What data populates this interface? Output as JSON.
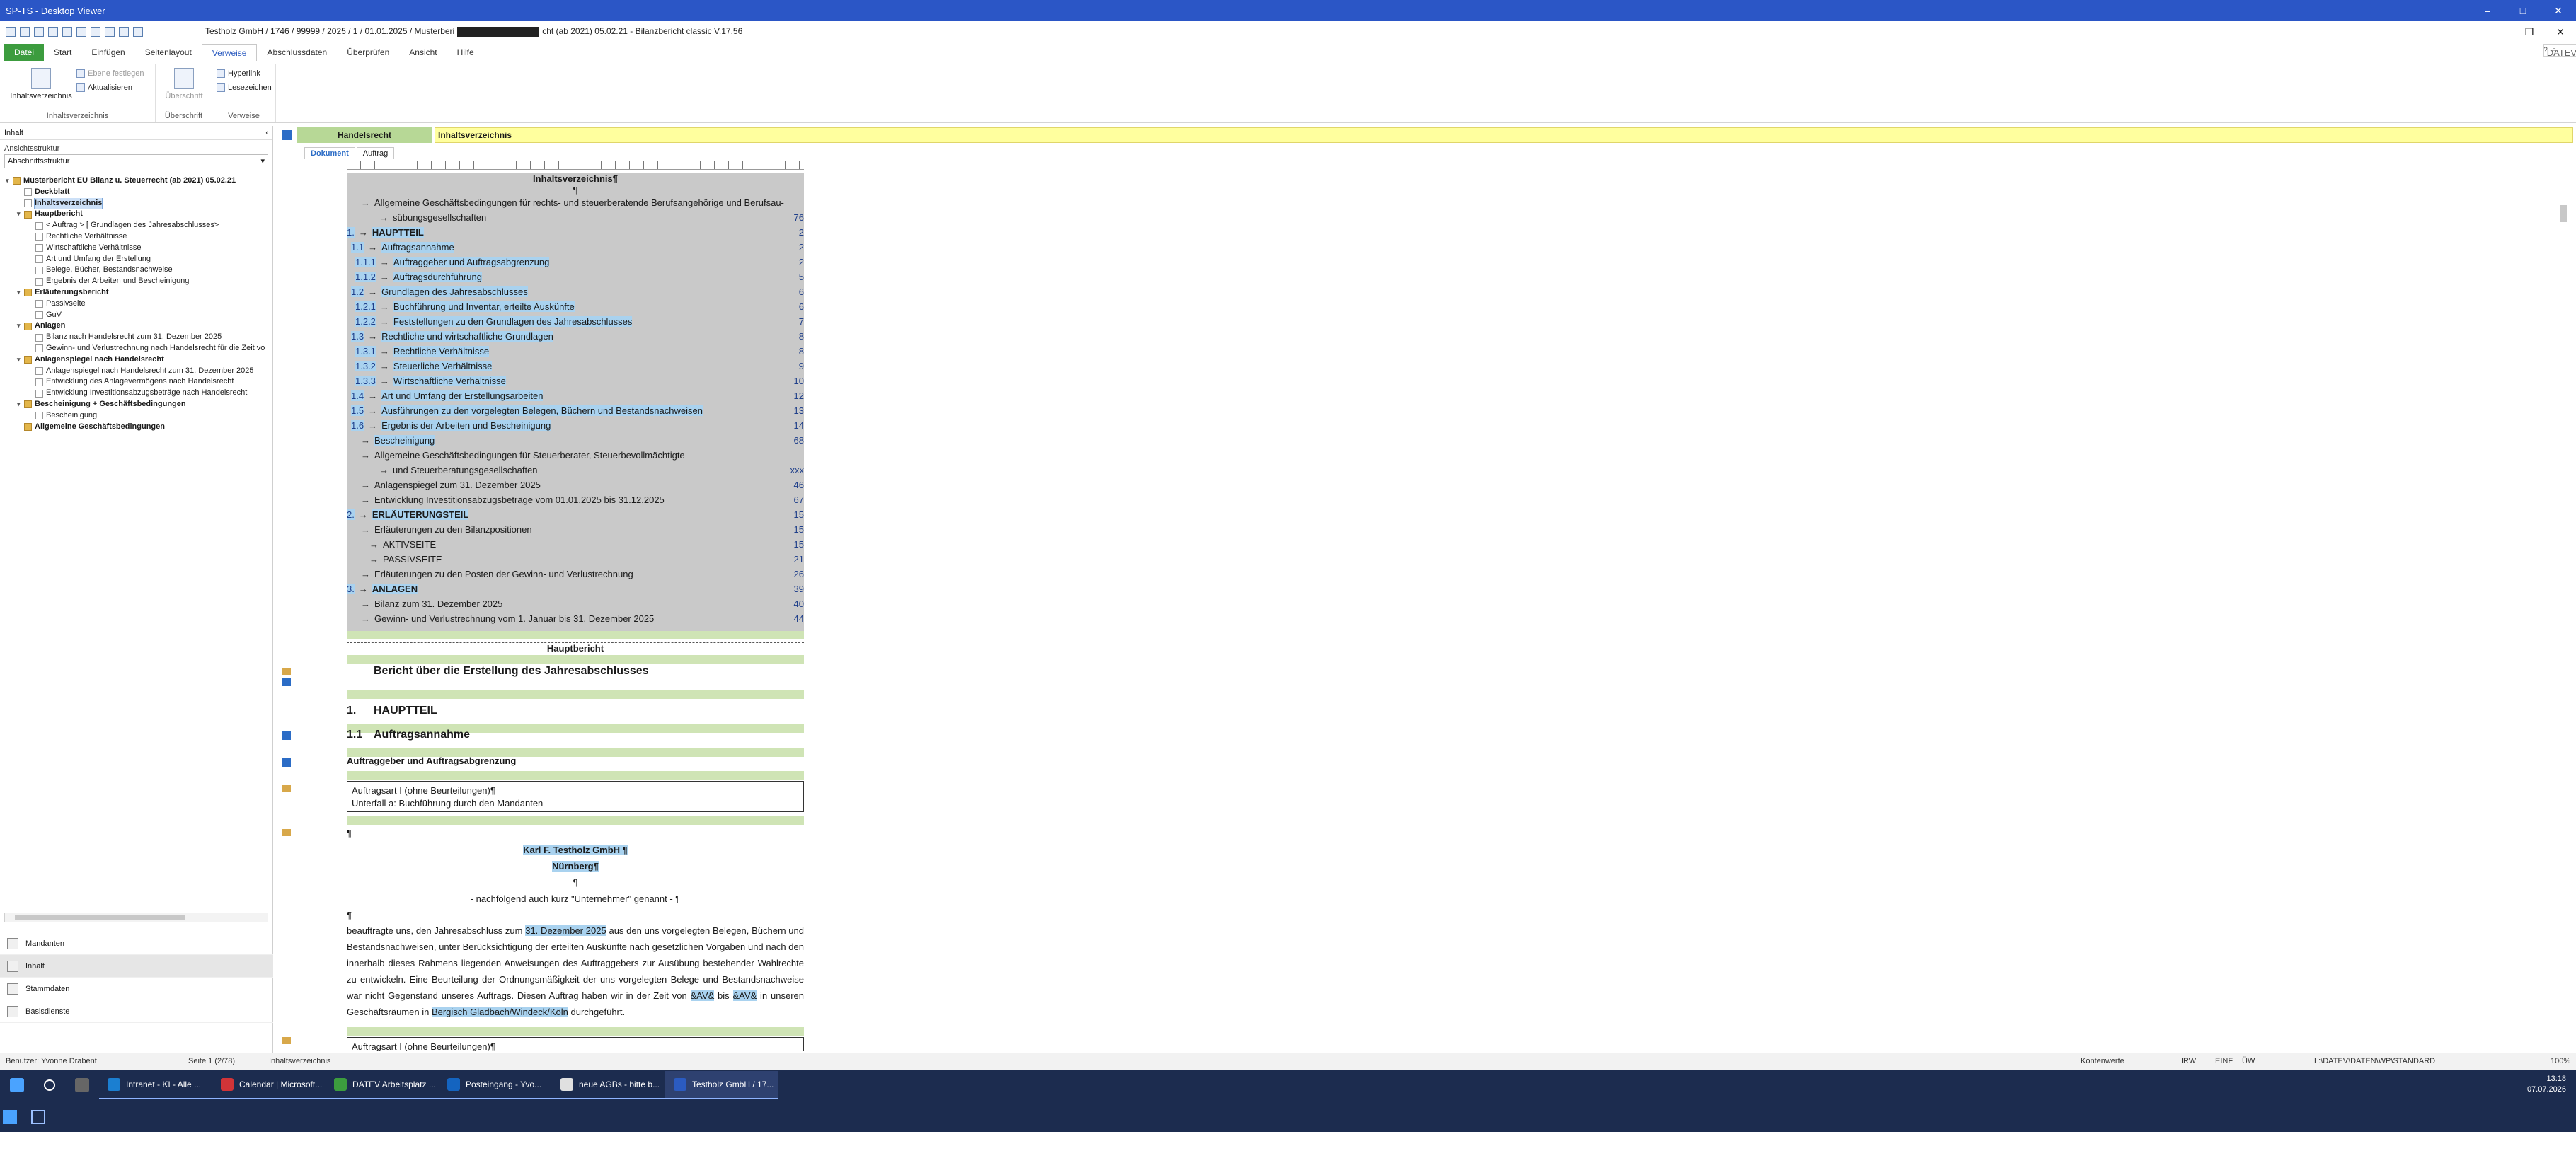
{
  "window": {
    "title": "SP-TS - Desktop Viewer",
    "controls": [
      "–",
      "□",
      "✕"
    ]
  },
  "quickaccess": {
    "doc_title_left": "Testholz GmbH / 1746 / 99999 / 2025 / 1 / 01.01.2025 / Musterberi",
    "doc_title_right": "cht (ab 2021) 05.02.21 - Bilanzbericht classic V.17.56",
    "controls": [
      "–",
      "❐",
      "✕"
    ]
  },
  "ribbon_tabs": [
    "Datei",
    "Start",
    "Einfügen",
    "Seitenlayout",
    "Verweise",
    "Abschlussdaten",
    "Überprüfen",
    "Ansicht",
    "Hilfe"
  ],
  "help": {
    "label": "DATEV Hilfe-Center"
  },
  "ribbon": {
    "inhaltsverzeichnis": "Inhaltsverzeichnis",
    "ebene_festlegen": "Ebene festlegen",
    "aktualisieren": "Aktualisieren",
    "group_inhalt": "Inhaltsverzeichnis",
    "ueberschrift": "Überschrift",
    "group_ueberschrift": "Überschrift",
    "hyperlink": "Hyperlink",
    "lesezeichen": "Lesezeichen",
    "group_verweise": "Verweise"
  },
  "leftpane": {
    "header": "Inhalt",
    "label": "Ansichtsstruktur",
    "select_value": "Abschnittsstruktur",
    "tree": [
      {
        "label": "Musterbericht EU Bilanz u. Steuerrecht (ab 2021) 05.02.21",
        "level": 0,
        "bold": true,
        "toggle": "▾",
        "folder": true
      },
      {
        "label": "Deckblatt",
        "level": 1,
        "bold": true,
        "toggle": "",
        "folder": false
      },
      {
        "label": "Inhaltsverzeichnis",
        "level": 1,
        "bold": true,
        "toggle": "",
        "folder": false,
        "selected": true
      },
      {
        "label": "Hauptbericht",
        "level": 1,
        "bold": true,
        "toggle": "▾",
        "folder": true
      },
      {
        "label": "< Auftrag > [ Grundlagen des Jahresabschlusses>",
        "level": 2,
        "bold": false,
        "toggle": "",
        "folder": false
      },
      {
        "label": "Rechtliche Verhältnisse",
        "level": 2,
        "bold": false,
        "toggle": "",
        "folder": false
      },
      {
        "label": "Wirtschaftliche Verhältnisse",
        "level": 2,
        "bold": false,
        "toggle": "",
        "folder": false
      },
      {
        "label": "Art und Umfang der Erstellung",
        "level": 2,
        "bold": false,
        "toggle": "",
        "folder": false
      },
      {
        "label": "Belege, Bücher, Bestandsnachweise",
        "level": 2,
        "bold": false,
        "toggle": "",
        "folder": false
      },
      {
        "label": "Ergebnis der Arbeiten und Bescheinigung",
        "level": 2,
        "bold": false,
        "toggle": "",
        "folder": false
      },
      {
        "label": "Erläuterungsbericht",
        "level": 1,
        "bold": true,
        "toggle": "▾",
        "folder": true
      },
      {
        "label": "Passivseite",
        "level": 2,
        "bold": false,
        "toggle": "",
        "folder": false
      },
      {
        "label": "GuV",
        "level": 2,
        "bold": false,
        "toggle": "",
        "folder": false
      },
      {
        "label": "Anlagen",
        "level": 1,
        "bold": true,
        "toggle": "▾",
        "folder": true
      },
      {
        "label": "Bilanz nach Handelsrecht zum 31. Dezember 2025",
        "level": 2,
        "bold": false,
        "toggle": "",
        "folder": false
      },
      {
        "label": "Gewinn- und Verlustrechnung nach Handelsrecht für die Zeit vo",
        "level": 2,
        "bold": false,
        "toggle": "",
        "folder": false
      },
      {
        "label": "Anlagenspiegel nach Handelsrecht",
        "level": 1,
        "bold": true,
        "toggle": "▾",
        "folder": true
      },
      {
        "label": "Anlagenspiegel nach Handelsrecht zum 31. Dezember 2025",
        "level": 2,
        "bold": false,
        "toggle": "",
        "folder": false
      },
      {
        "label": "Entwicklung des Anlagevermögens nach Handelsrecht",
        "level": 2,
        "bold": false,
        "toggle": "",
        "folder": false
      },
      {
        "label": "Entwicklung Investitionsabzugsbeträge nach Handelsrecht",
        "level": 2,
        "bold": false,
        "toggle": "",
        "folder": false
      },
      {
        "label": "Bescheinigung + Geschäftsbedingungen",
        "level": 1,
        "bold": true,
        "toggle": "▾",
        "folder": true
      },
      {
        "label": "Bescheinigung",
        "level": 2,
        "bold": false,
        "toggle": "",
        "folder": false
      },
      {
        "label": "Allgemeine Geschäftsbedingungen",
        "level": 1,
        "bold": true,
        "toggle": "",
        "folder": true
      }
    ],
    "nav": [
      "Mandanten",
      "Inhalt",
      "Stammdaten",
      "Basisdienste"
    ]
  },
  "docbar": {
    "handelsrecht": "Handelsrecht",
    "inhaltsverzeichnis": "Inhaltsverzeichnis",
    "tabs": [
      "Dokument",
      "Auftrag"
    ]
  },
  "toc": {
    "title": "Inhaltsverzeichnis¶",
    "para": "¶",
    "rows": [
      {
        "num": "",
        "text": "Allgemeine Geschäftsbedingungen für rechts- und steuerberatende Berufsangehörige und Berufsau-",
        "page": "",
        "bold": false,
        "hl": false,
        "indent": 14
      },
      {
        "num": "",
        "text": "sübungsgesellschaften",
        "page": "76",
        "bold": false,
        "hl": false,
        "indent": 40
      },
      {
        "num": "1.",
        "text": "HAUPTTEIL",
        "page": "2",
        "bold": true,
        "hl": true,
        "indent": 0
      },
      {
        "num": "1.1",
        "text": "Auftragsannahme",
        "page": "2",
        "bold": false,
        "hl": true,
        "indent": 6
      },
      {
        "num": "1.1.1",
        "text": "Auftraggeber und Auftragsabgrenzung",
        "page": "2",
        "bold": false,
        "hl": true,
        "indent": 12
      },
      {
        "num": "1.1.2",
        "text": "Auftragsdurchführung",
        "page": "5",
        "bold": false,
        "hl": true,
        "indent": 12
      },
      {
        "num": "1.2",
        "text": "Grundlagen des Jahresabschlusses",
        "page": "6",
        "bold": false,
        "hl": true,
        "indent": 6
      },
      {
        "num": "1.2.1",
        "text": "Buchführung und Inventar, erteilte Auskünfte",
        "page": "6",
        "bold": false,
        "hl": true,
        "indent": 12
      },
      {
        "num": "1.2.2",
        "text": "Feststellungen zu den Grundlagen des Jahresabschlusses",
        "page": "7",
        "bold": false,
        "hl": true,
        "indent": 12
      },
      {
        "num": "1.3",
        "text": "Rechtliche und wirtschaftliche Grundlagen",
        "page": "8",
        "bold": false,
        "hl": true,
        "indent": 6
      },
      {
        "num": "1.3.1",
        "text": "Rechtliche Verhältnisse",
        "page": "8",
        "bold": false,
        "hl": true,
        "indent": 12
      },
      {
        "num": "1.3.2",
        "text": "Steuerliche Verhältnisse",
        "page": "9",
        "bold": false,
        "hl": true,
        "indent": 12
      },
      {
        "num": "1.3.3",
        "text": "Wirtschaftliche Verhältnisse",
        "page": "10",
        "bold": false,
        "hl": true,
        "indent": 12
      },
      {
        "num": "1.4",
        "text": "Art und Umfang der Erstellungsarbeiten",
        "page": "12",
        "bold": false,
        "hl": true,
        "indent": 6
      },
      {
        "num": "1.5",
        "text": "Ausführungen zu den vorgelegten Belegen, Büchern und Bestandsnachweisen",
        "page": "13",
        "bold": false,
        "hl": true,
        "indent": 6
      },
      {
        "num": "1.6",
        "text": "Ergebnis der Arbeiten und Bescheinigung",
        "page": "14",
        "bold": false,
        "hl": true,
        "indent": 6
      },
      {
        "num": "",
        "text": "Bescheinigung",
        "page": "68",
        "bold": false,
        "hl": true,
        "indent": 14
      },
      {
        "num": "",
        "text": "Allgemeine Geschäftsbedingungen für Steuerberater, Steuerbevollmächtigte",
        "page": "",
        "bold": false,
        "hl": false,
        "indent": 14
      },
      {
        "num": "",
        "text": "und Steuerberatungsgesellschaften",
        "page": "xxx",
        "bold": false,
        "hl": false,
        "indent": 40
      },
      {
        "num": "",
        "text": "Anlagenspiegel zum 31. Dezember 2025",
        "page": "46",
        "bold": false,
        "hl": false,
        "indent": 14
      },
      {
        "num": "",
        "text": "Entwicklung Investitionsabzugsbeträge vom 01.01.2025 bis 31.12.2025",
        "page": "67",
        "bold": false,
        "hl": false,
        "indent": 14
      },
      {
        "num": "2.",
        "text": "ERLÄUTERUNGSTEIL",
        "page": "15",
        "bold": true,
        "hl": true,
        "indent": 0
      },
      {
        "num": "",
        "text": "Erläuterungen zu den Bilanzpositionen",
        "page": "15",
        "bold": false,
        "hl": false,
        "indent": 14
      },
      {
        "num": "",
        "text": "AKTIVSEITE",
        "page": "15",
        "bold": false,
        "hl": false,
        "indent": 26
      },
      {
        "num": "",
        "text": "PASSIVSEITE",
        "page": "21",
        "bold": false,
        "hl": false,
        "indent": 26
      },
      {
        "num": "",
        "text": "Erläuterungen zu den Posten der Gewinn- und Verlustrechnung",
        "page": "26",
        "bold": false,
        "hl": false,
        "indent": 14
      },
      {
        "num": "3.",
        "text": "ANLAGEN",
        "page": "39",
        "bold": true,
        "hl": true,
        "indent": 0
      },
      {
        "num": "",
        "text": "Bilanz zum 31. Dezember 2025",
        "page": "40",
        "bold": false,
        "hl": false,
        "indent": 14
      },
      {
        "num": "",
        "text": "Gewinn- und Verlustrechnung vom 1. Januar bis 31. Dezember 2025",
        "page": "44",
        "bold": false,
        "hl": false,
        "indent": 14
      }
    ]
  },
  "body": {
    "section": "Hauptbericht",
    "heading": "Bericht über die Erstellung des Jahresabschlusses",
    "h1_num": "1.",
    "h1": "HAUPTTEIL",
    "h2_num": "1.1",
    "h2": "Auftragsannahme",
    "h3": "Auftraggeber und Auftragsabgrenzung",
    "box_line1": "Auftragsart I (ohne Beurteilungen)¶",
    "box_line2": "Unterfall a: Buchführung durch den Mandanten",
    "para1": "¶",
    "company": "Karl F. Testholz GmbH ¶",
    "city": "Nürnberg¶",
    "para2": "¶",
    "alias": "- nachfolgend auch kurz \"Unternehmer\" genannt - ¶",
    "para3": "¶",
    "text_a": "beauftragte uns, den Jahresabschluss zum ",
    "text_date": "31. Dezember 2025",
    "text_b": " aus den uns vorgelegten Belegen, Büchern und Bestandsnachweisen, unter Berücksichtigung der erteilten Auskünfte nach gesetzlichen Vorgaben und nach den innerhalb dieses Rahmens liegenden Anweisungen des Auftraggebers zur Ausübung bestehender Wahlrechte zu entwickeln. Eine Beurteilung der Ordnungsmäßigkeit der uns vorgelegten Belege und Bestandsnachweise war nicht Gegenstand unseres Auftrags. Diesen Auftrag haben wir in der Zeit von ",
    "text_av1": "&AV&",
    "text_c": " bis ",
    "text_av2": "&AV&",
    "text_d": " in unseren Geschäftsräumen in ",
    "text_place": "Bergisch Gladbach/Windeck/Köln",
    "text_e": " durchgeführt.",
    "box2": "Auftragsart I (ohne Beurteilungen)¶"
  },
  "status": {
    "user": "Benutzer: Yvonne Drabent",
    "page": "Seite 1 (2/78)",
    "section": "Inhaltsverzeichnis",
    "kontenwerte": "Kontenwerte",
    "irw": "IRW",
    "einf": "EINF",
    "uw": "ÜW",
    "path": "L:\\DATEV\\DATEN\\WP\\STANDARD",
    "zoom": "100%"
  },
  "taskbar": {
    "apps": [
      {
        "label": "Intranet - KI - Alle ...",
        "color": "#1b7fd1",
        "active": false
      },
      {
        "label": "Calendar | Microsoft...",
        "color": "#d13438",
        "active": false
      },
      {
        "label": "DATEV Arbeitsplatz ...",
        "color": "#3c9c3e",
        "active": false
      },
      {
        "label": "Posteingang - Yvo...",
        "color": "#1464c0",
        "active": false
      },
      {
        "label": "neue AGBs - bitte b...",
        "color": "#e0e0e0",
        "active": false
      },
      {
        "label": "Testholz GmbH / 17...",
        "color": "#2b5bc0",
        "active": true
      }
    ],
    "time": "13:18",
    "date": "07.07.2026",
    "time2": "13:18",
    "date2": "07.07.2026"
  }
}
